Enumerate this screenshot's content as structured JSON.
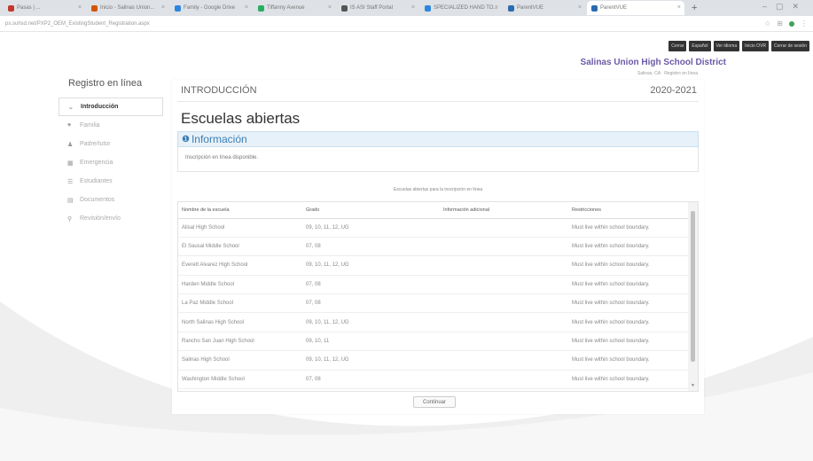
{
  "browser": {
    "tabs": [
      {
        "label": "Pasas | ...",
        "color": "#c0392b"
      },
      {
        "label": "Inicio - Salinas Union...",
        "color": "#d35400"
      },
      {
        "label": "Family - Google Drive",
        "color": "#2e86de"
      },
      {
        "label": "Tiffanny Avenue",
        "color": "#27ae60"
      },
      {
        "label": "IS ASI Staff Portal",
        "color": "#555"
      },
      {
        "label": "SPECIALIZED HAND TO...",
        "color": "#2e86de"
      },
      {
        "label": "ParentVUE",
        "color": "#2a6bb0"
      },
      {
        "label": "ParentVUE",
        "color": "#2a6bb0"
      }
    ],
    "url": "ps.suhsd.net/PXP2_OEM_ExistingStudent_Registration.aspx"
  },
  "header": {
    "buttons": [
      "Cerrar",
      "Español",
      "Ver idioma",
      "Inicio OVR",
      "Cerrar de sesión"
    ],
    "district": "Salinas Union High School District",
    "district_sub": "Salinas, CA · Registro en línea"
  },
  "sidebar": {
    "title": "Registro en línea",
    "items": [
      {
        "label": "Introducción",
        "icon": "chevron-icon"
      },
      {
        "label": "Familia",
        "icon": "family-icon"
      },
      {
        "label": "Padre/tutor",
        "icon": "person-icon"
      },
      {
        "label": "Emergencia",
        "icon": "emergency-icon"
      },
      {
        "label": "Estudiantes",
        "icon": "students-icon"
      },
      {
        "label": "Documentos",
        "icon": "documents-icon"
      },
      {
        "label": "Revisión/envío",
        "icon": "review-icon"
      }
    ]
  },
  "main": {
    "section": "INTRODUCCIÓN",
    "year": "2020-2021",
    "heading": "Escuelas abiertas",
    "info_title": "Información",
    "info_body": "Inscripción en línea disponible.",
    "caption": "Escuelas abiertas para la inscripción en línea",
    "columns": [
      "Nombre de la escuela",
      "Grado",
      "Información adicional",
      "Restricciones"
    ],
    "rows": [
      [
        "Alisal High School",
        "09, 10, 11, 12, UG",
        "",
        "Must live within school boundary."
      ],
      [
        "El Sausal Middle School",
        "07, 08",
        "",
        "Must live within school boundary."
      ],
      [
        "Everett Alvarez High School",
        "09, 10, 11, 12, UG",
        "",
        "Must live within school boundary."
      ],
      [
        "Harden Middle School",
        "07, 08",
        "",
        "Must live within school boundary."
      ],
      [
        "La Paz Middle School",
        "07, 08",
        "",
        "Must live within school boundary."
      ],
      [
        "North Salinas High School",
        "09, 10, 11, 12, UG",
        "",
        "Must live within school boundary."
      ],
      [
        "Rancho San Juan High School",
        "09, 10, 11",
        "",
        "Must live within school boundary."
      ],
      [
        "Salinas High School",
        "09, 10, 11, 12, UG",
        "",
        "Must live within school boundary."
      ],
      [
        "Washington Middle School",
        "07, 08",
        "",
        "Must live within school boundary."
      ]
    ],
    "continue_label": "Continuar"
  }
}
